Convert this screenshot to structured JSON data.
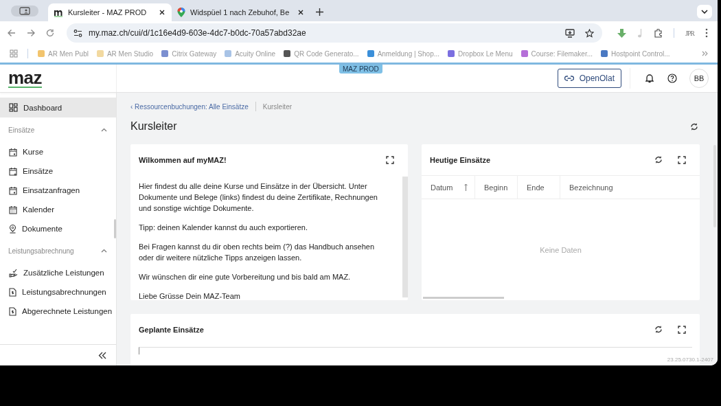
{
  "browser": {
    "tabs": [
      {
        "title": "Kursleiter - MAZ PROD",
        "selected": true
      },
      {
        "title": "Widspüel 1 nach Zebuhof, Be",
        "selected": false
      }
    ],
    "address": "my.maz.ch/cui/d/1c16e4d9-603e-4dc7-b0dc-70a57abd32ae",
    "profile": "JPR",
    "bookmarks": [
      {
        "label": "AR Men Publ",
        "color": "#f2c46d"
      },
      {
        "label": "AR Men Studio",
        "color": "#f2d9a0"
      },
      {
        "label": "Citrix Gateway",
        "color": "#7b8fd0"
      },
      {
        "label": "Acuity Online",
        "color": "#a8c3e6"
      },
      {
        "label": "QR Code Generato...",
        "color": "#555555"
      },
      {
        "label": "Anmeldung | Shop...",
        "color": "#3b8fd9"
      },
      {
        "label": "Dropbox Le Menu",
        "color": "#7b6fe0"
      },
      {
        "label": "Course: Filemaker...",
        "color": "#b56fd8"
      },
      {
        "label": "Hostpoint Control...",
        "color": "#4a79c2"
      }
    ]
  },
  "app": {
    "logo": "maz",
    "env_badge": "MAZ PROD",
    "header_button": "OpenOlat",
    "avatar": "BB",
    "sidebar": {
      "items": [
        {
          "label": "Dashboard",
          "selected": true
        }
      ],
      "sections": [
        {
          "title": "Einsätze",
          "expanded": true,
          "items": [
            {
              "label": "Kurse",
              "selected": false
            },
            {
              "label": "Einsätze",
              "selected": false
            },
            {
              "label": "Einsatzanfragen",
              "selected": false
            },
            {
              "label": "Kalender",
              "selected": false
            },
            {
              "label": "Dokumente",
              "selected": false
            }
          ]
        },
        {
          "title": "Leistungsabrechnung",
          "expanded": true,
          "items": [
            {
              "label": "Zusätzliche Leistungen",
              "selected": false
            },
            {
              "label": "Leistungsabrechnungen",
              "selected": false
            },
            {
              "label": "Abgerechnete Leistungen",
              "selected": false
            }
          ]
        }
      ]
    },
    "breadcrumb": {
      "link": "‹ Ressourcenbuchungen: Alle Einsätze",
      "current": "Kursleiter"
    },
    "page_title": "Kursleiter",
    "welcome_card": {
      "title": "Wilkommen auf myMAZ!",
      "paragraphs": [
        "Hier findest du alle deine Kurse und Einsätze in der Übersicht. Unter Dokumente und Belege (links) findest du deine Zertifikate, Rechnungen und sonstige wichtige Dokumente.",
        "Tipp: deinen Kalender kannst du auch exportieren.",
        "Bei Fragen kannst du dir oben rechts beim (?) das Handbuch ansehen oder dir weitere nützliche Tipps anzeigen lassen.",
        "Wir wünschen dir eine gute Vorbereitung und bis bald am MAZ.",
        "Liebe Grüsse Dein MAZ-Team"
      ]
    },
    "today_card": {
      "title": "Heutige Einsätze",
      "columns": [
        {
          "label": "Datum",
          "sorted": true
        },
        {
          "label": "Beginn",
          "sorted": false
        },
        {
          "label": "Ende",
          "sorted": false
        },
        {
          "label": "Bezeichnung",
          "sorted": false
        }
      ],
      "empty_text": "Keine Daten"
    },
    "planned_card": {
      "title": "Geplante Einsätze"
    },
    "version": "23.25.0730.1-2407"
  }
}
